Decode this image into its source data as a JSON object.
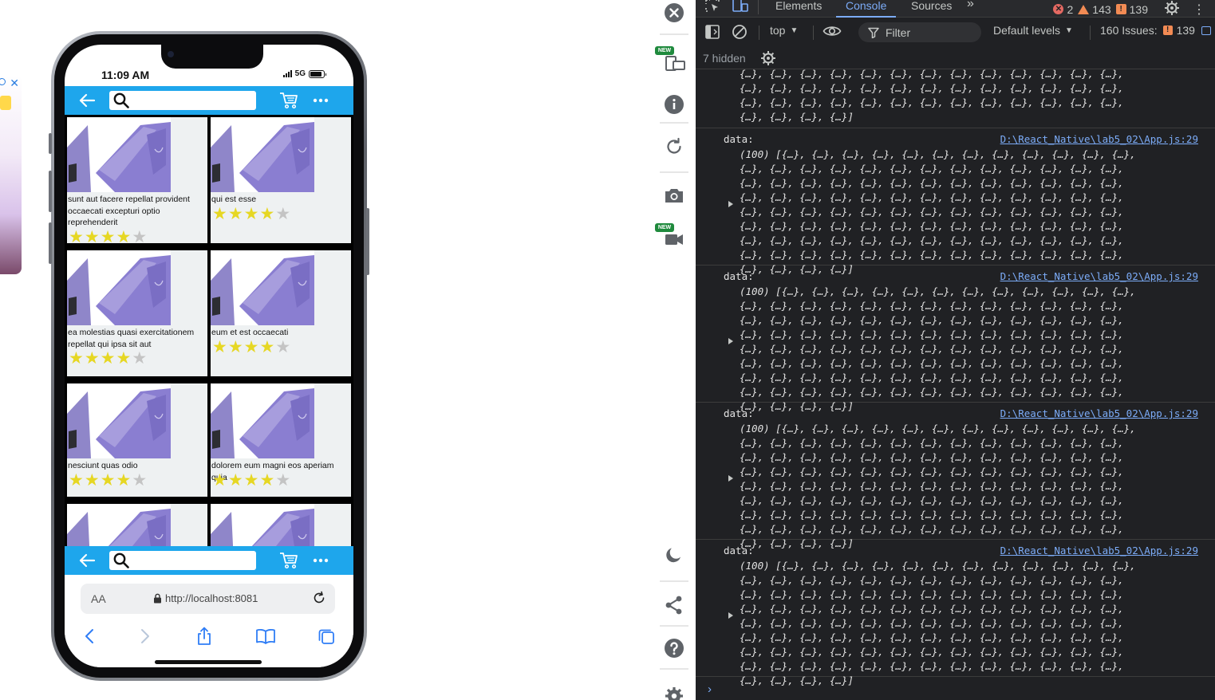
{
  "phone": {
    "status_time": "11:09 AM",
    "network": "5G"
  },
  "app": {
    "search_placeholder": "",
    "products": [
      {
        "title": "sunt aut facere repellat provident occaecati excepturi optio reprehenderit",
        "rating": 4
      },
      {
        "title": "qui est esse",
        "rating": 4
      },
      {
        "title": "ea molestias quasi exercitationem repellat qui ipsa sit aut",
        "rating": 4
      },
      {
        "title": "eum et est occaecati",
        "rating": 4
      },
      {
        "title": "nesciunt quas odio",
        "rating": 4
      },
      {
        "title": "dolorem eum magni eos aperiam quia",
        "rating": 4
      },
      {
        "title": "",
        "rating": 0
      },
      {
        "title": "",
        "rating": 0
      }
    ],
    "colors": {
      "appbar": "#1ea6ec",
      "star_on": "#e6d723",
      "star_off": "#c4c4c4",
      "card_bg": "#eef1f2"
    }
  },
  "browser": {
    "font_size_label": "AA",
    "url": "http://localhost:8081"
  },
  "device_toolbar": {
    "badges": [
      "NEW",
      "NEW"
    ]
  },
  "devtools": {
    "tabs": [
      "Elements",
      "Console",
      "Sources"
    ],
    "active_tab": "Console",
    "error_count": "2",
    "warning_count": "143",
    "issue_count": "139",
    "context": "top",
    "filter_placeholder": "Filter",
    "levels": "Default levels",
    "issues_label": "160 Issues:",
    "issues_count": "139",
    "hidden_label": "7 hidden",
    "first_entry_tail": [
      "{…}, {…}, {…}, {…}, {…}, {…}, {…}, {…}, {…}, {…}, {…}, {…}, {…},",
      "{…}, {…}, {…}, {…}, {…}, {…}, {…}, {…}, {…}, {…}, {…}, {…}, {…},",
      "{…}, {…}, {…}, {…}, {…}, {…}, {…}, {…}, {…}, {…}, {…}, {…}, {…},",
      "{…}, {…}, {…}, {…}]"
    ],
    "entries": [
      {
        "label": "data:",
        "source": "D:\\React_Native\\lab5_02\\App.js:29",
        "first_line": "(100) [{…}, {…}, {…}, {…}, {…}, {…}, {…}, {…}, {…}, {…}, {…}, {…},"
      },
      {
        "label": "data:",
        "source": "D:\\React_Native\\lab5_02\\App.js:29",
        "first_line": "(100) [{…}, {…}, {…}, {…}, {…}, {…}, {…}, {…}, {…}, {…}, {…}, {…},"
      },
      {
        "label": "data:",
        "source": "D:\\React_Native\\lab5_02\\App.js:29",
        "first_line": "(100) [{…}, {…}, {…}, {…}, {…}, {…}, {…}, {…}, {…}, {…}, {…}, {…},"
      },
      {
        "label": "data:",
        "source": "D:\\React_Native\\lab5_02\\App.js:29",
        "first_line": "(100) [{…}, {…}, {…}, {…}, {…}, {…}, {…}, {…}, {…}, {…}, {…}, {…},"
      }
    ],
    "entry_middle_line": "{…}, {…}, {…}, {…}, {…}, {…}, {…}, {…}, {…}, {…}, {…}, {…}, {…},",
    "entry_last_line": "{…}, {…}, {…}, {…}]"
  }
}
